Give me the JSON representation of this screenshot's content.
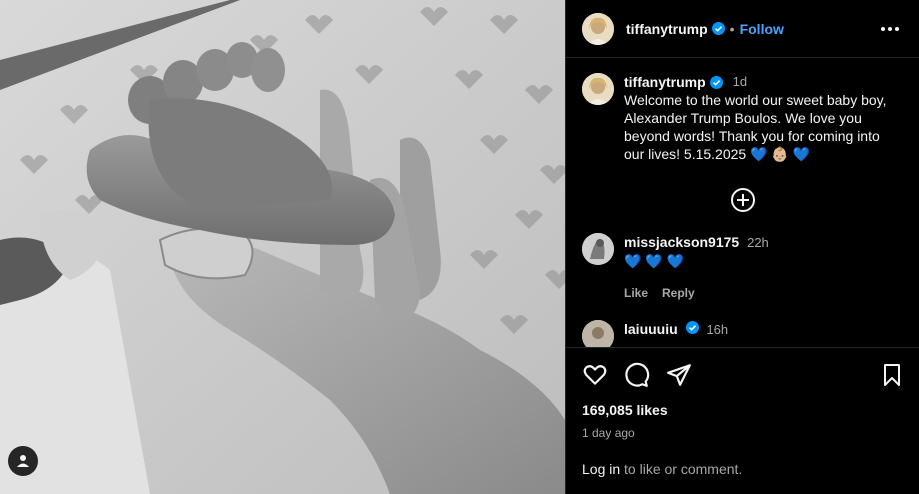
{
  "post": {
    "username": "tiffanytrump",
    "follow_label": "Follow",
    "dot": "•"
  },
  "caption": {
    "username": "tiffanytrump",
    "time": "1d",
    "text": "Welcome to the world our sweet baby boy, Alexander Trump Boulos. We love you beyond words! Thank you for coming into our lives! 5.15.2025 💙 👶🏼 💙"
  },
  "comments": [
    {
      "username": "missjackson9175",
      "time": "22h",
      "text": "💙 💙 💙",
      "like_label": "Like",
      "reply_label": "Reply"
    },
    {
      "username": "laiuuuiu",
      "time": "16h"
    }
  ],
  "stats": {
    "likes": "169,085 likes",
    "date": "1 day ago"
  },
  "login": {
    "link": "Log in",
    "rest": " to like or comment."
  },
  "icons": {
    "verified": "verified-badge-icon",
    "more": "more-options-icon",
    "add": "plus-circle-icon",
    "like": "heart-icon",
    "comment": "comment-icon",
    "share": "share-icon",
    "save": "bookmark-icon",
    "tag": "user-tag-icon"
  },
  "colors": {
    "accent": "#4aa3ff",
    "verified": "#0095f6"
  }
}
